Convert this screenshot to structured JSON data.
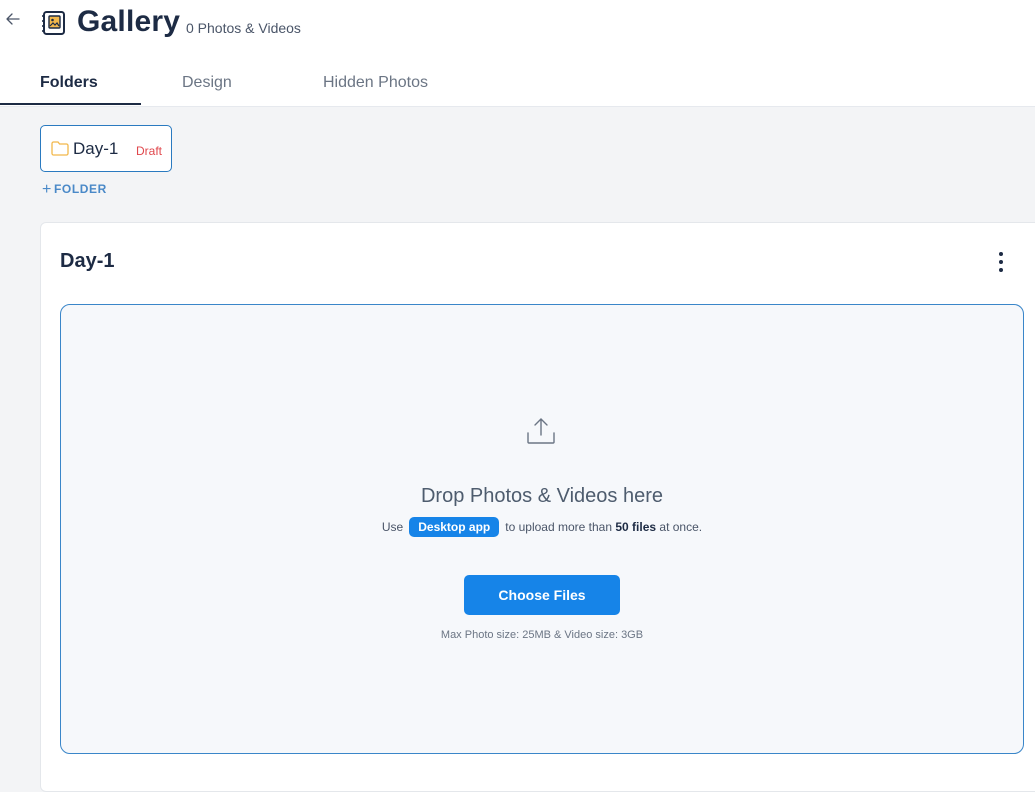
{
  "header": {
    "title": "Gallery",
    "count_label": "0 Photos & Videos",
    "back_icon": "arrow-left-icon",
    "album_icon": "photo-album-icon"
  },
  "tabs": [
    {
      "label": "Folders",
      "active": true
    },
    {
      "label": "Design",
      "active": false
    },
    {
      "label": "Hidden Photos",
      "active": false
    }
  ],
  "folders": [
    {
      "name": "Day-1",
      "status": "Draft",
      "icon": "folder-icon"
    }
  ],
  "add_folder_label": "FOLDER",
  "card": {
    "title": "Day-1",
    "menu_icon": "more-vertical-icon"
  },
  "dropzone": {
    "icon": "upload-icon",
    "title": "Drop Photos & Videos here",
    "hint_prefix": "Use",
    "hint_button": "Desktop app",
    "hint_middle": "to upload more than",
    "hint_bold": "50 files",
    "hint_suffix": "at once.",
    "button_label": "Choose Files",
    "limits": "Max Photo size: 25MB & Video size: 3GB"
  },
  "colors": {
    "primary": "#1684e8",
    "draft": "#e0474c",
    "title": "#1d2b44",
    "folder_icon": "#f2b84b"
  }
}
